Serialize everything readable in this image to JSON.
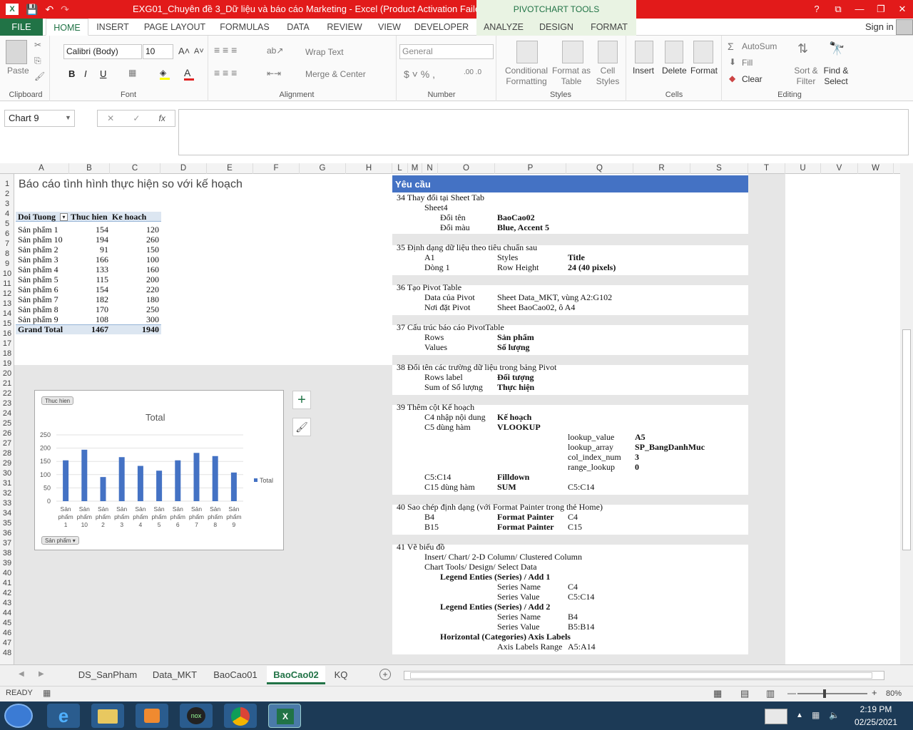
{
  "window": {
    "title": "EXG01_Chuyên đề 3_Dữ liệu và báo cáo Marketing -  Excel (Product Activation Failed)",
    "contextual_tab": "PIVOTCHART TOOLS",
    "controls": [
      "?",
      "⧉",
      "—",
      "❐",
      "✕"
    ]
  },
  "ribbon_tabs": [
    "FILE",
    "HOME",
    "INSERT",
    "PAGE LAYOUT",
    "FORMULAS",
    "DATA",
    "REVIEW",
    "VIEW",
    "DEVELOPER",
    "ANALYZE",
    "DESIGN",
    "FORMAT"
  ],
  "signin": "Sign in",
  "ribbon": {
    "clipboard": {
      "paste": "Paste",
      "label": "Clipboard"
    },
    "font": {
      "name": "Calibri (Body)",
      "size": "10",
      "label": "Font"
    },
    "alignment": {
      "wrap": "Wrap Text",
      "merge": "Merge & Center",
      "label": "Alignment"
    },
    "number": {
      "format": "General",
      "label": "Number"
    },
    "styles": {
      "cond": "Conditional",
      "cond2": "Formatting",
      "fmt": "Format as",
      "fmt2": "Table",
      "cell": "Cell",
      "cell2": "Styles",
      "label": "Styles"
    },
    "cells": {
      "insert": "Insert",
      "delete": "Delete",
      "format": "Format",
      "label": "Cells"
    },
    "editing": {
      "autosum": "AutoSum",
      "fill": "Fill",
      "clear": "Clear",
      "sort": "Sort &",
      "sort2": "Filter",
      "find": "Find &",
      "find2": "Select",
      "label": "Editing"
    }
  },
  "formula_bar": {
    "name_box": "Chart 9",
    "fx": "fx",
    "content": ""
  },
  "columns": [
    "A",
    "B",
    "C",
    "D",
    "E",
    "F",
    "G",
    "H",
    "L",
    "M",
    "N",
    "O",
    "P",
    "Q",
    "R",
    "S",
    "T",
    "U",
    "V",
    "W"
  ],
  "rows": [
    "1",
    "2",
    "3",
    "4",
    "5",
    "6",
    "7",
    "8",
    "9",
    "10",
    "11",
    "12",
    "13",
    "14",
    "15",
    "16",
    "17",
    "18",
    "19",
    "20",
    "21",
    "22",
    "23",
    "24",
    "25",
    "26",
    "27",
    "28",
    "29",
    "30",
    "31",
    "32",
    "33",
    "34",
    "35",
    "36",
    "37",
    "38",
    "39",
    "40",
    "41",
    "42",
    "43",
    "44",
    "45",
    "46",
    "47",
    "48"
  ],
  "sheet": {
    "title": "Báo cáo tình hình thực hiện so với kế hoạch",
    "pivot_headers": [
      "Doi Tuong",
      "Thuc hien",
      "Ke hoach"
    ],
    "pivot_rows": [
      [
        "Sản phẩm 1",
        "154",
        "120"
      ],
      [
        "Sản phẩm 10",
        "194",
        "260"
      ],
      [
        "Sản phẩm 2",
        "91",
        "150"
      ],
      [
        "Sản phẩm 3",
        "166",
        "100"
      ],
      [
        "Sản phẩm 4",
        "133",
        "160"
      ],
      [
        "Sản phẩm 5",
        "115",
        "200"
      ],
      [
        "Sản phẩm 6",
        "154",
        "220"
      ],
      [
        "Sản phẩm 7",
        "182",
        "180"
      ],
      [
        "Sản phẩm 8",
        "170",
        "250"
      ],
      [
        "Sản phẩm 9",
        "108",
        "300"
      ]
    ],
    "grand_total": [
      "Grand Total",
      "1467",
      "1940"
    ]
  },
  "chart_data": {
    "type": "bar",
    "title": "Total",
    "field_button_top": "Thuc hien",
    "field_button_bottom": "Sản phẩm",
    "categories": [
      "Sản phẩm 1",
      "Sản phẩm 10",
      "Sản phẩm 2",
      "Sản phẩm 3",
      "Sản phẩm 4",
      "Sản phẩm 5",
      "Sản phẩm 6",
      "Sản phẩm 7",
      "Sản phẩm 8",
      "Sản phẩm 9"
    ],
    "category_lines": [
      [
        "Sản",
        "phẩm",
        "1"
      ],
      [
        "Sản",
        "phẩm",
        "10"
      ],
      [
        "Sản",
        "phẩm",
        "2"
      ],
      [
        "Sản",
        "phẩm",
        "3"
      ],
      [
        "Sản",
        "phẩm",
        "4"
      ],
      [
        "Sản",
        "phẩm",
        "5"
      ],
      [
        "Sản",
        "phẩm",
        "6"
      ],
      [
        "Sản",
        "phẩm",
        "7"
      ],
      [
        "Sản",
        "phẩm",
        "8"
      ],
      [
        "Sản",
        "phẩm",
        "9"
      ]
    ],
    "series": [
      {
        "name": "Total",
        "values": [
          154,
          194,
          91,
          166,
          133,
          115,
          154,
          182,
          170,
          108
        ],
        "color": "#4472c4"
      }
    ],
    "yticks": [
      "250",
      "200",
      "150",
      "100",
      "50",
      "0"
    ],
    "ylim": [
      0,
      250
    ],
    "legend_position": "right",
    "grid": true
  },
  "requirements": {
    "header": "Yêu cầu",
    "lines": [
      {
        "row": "34",
        "a": "34  Thay đổi tại Sheet Tab"
      },
      {
        "row": "35",
        "b": "Sheet4"
      },
      {
        "row": "36",
        "c": "Đổi tên",
        "d": "BaoCao02"
      },
      {
        "row": "37",
        "c": "Đổi màu",
        "d": "Blue, Accent 5"
      },
      {
        "row": "35b",
        "a": "35  Định dạng dữ liệu theo tiêu chuẩn sau"
      },
      {
        "b": "A1",
        "d2": "Styles",
        "e": "Title"
      },
      {
        "b": "Dòng 1",
        "d2": "Row Height",
        "e": "24 (40 pixels)"
      },
      {
        "a": "36  Tạo Pivot Table"
      },
      {
        "b": "Data của Pivot",
        "d2": "Sheet Data_MKT,  vùng A2:G102"
      },
      {
        "b": "Nơi đặt Pivot",
        "d2": "Sheet BaoCao02, ô A4"
      },
      {
        "a": "37  Cấu trúc báo cáo PivotTable"
      },
      {
        "b": "Rows",
        "d": "Sản phẩm"
      },
      {
        "b": "Values",
        "d": "Số lượng"
      },
      {
        "a": "38  Đổi tên các trường dữ liệu trong bảng Pivot"
      },
      {
        "b": "Rows label",
        "d": "Đối tượng"
      },
      {
        "b": "Sum of Số lượng",
        "d": "Thực hiện"
      },
      {
        "a": "39  Thêm cột Kế hoạch"
      },
      {
        "b": "C4 nhập nội dung",
        "d": "Kế hoạch"
      },
      {
        "b": "C5 dùng hàm",
        "d": "VLOOKUP"
      },
      {
        "e2": "lookup_value",
        "f": "A5"
      },
      {
        "e2": "lookup_array",
        "f": "SP_BangDanhMuc"
      },
      {
        "e2": "col_index_num",
        "f": "3"
      },
      {
        "e2": "range_lookup",
        "f": "0"
      },
      {
        "b": "C5:C14",
        "d": "Filldown"
      },
      {
        "b": "C15 dùng hàm",
        "d": "SUM",
        "e2": "C5:C14"
      },
      {
        "a": "40  Sao chép định dạng (với Format Painter trong thẻ Home)"
      },
      {
        "b": "B4",
        "d": "Format Painter",
        "e2": "C4"
      },
      {
        "b": "B15",
        "d": "Format Painter",
        "e2": "C15"
      },
      {
        "a": "41  Vẽ biểu đồ"
      },
      {
        "b": "Insert/ Chart/ 2-D Column/ Clustered Column"
      },
      {
        "b": "Chart Tools/ Design/ Select Data"
      },
      {
        "c": "Legend Enties (Series) / Add 1"
      },
      {
        "d2": "Series Name",
        "e2": "C4"
      },
      {
        "d2": "Series Value",
        "e2": "C5:C14"
      },
      {
        "c": "Legend Enties (Series) / Add 2"
      },
      {
        "d2": "Series Name",
        "e2": "B4"
      },
      {
        "d2": "Series Value",
        "e2": "B5:B14"
      },
      {
        "c": "Horizontal (Categories) Axis Labels"
      },
      {
        "d2": "Axis Labels Range",
        "e2": "A5:A14"
      }
    ]
  },
  "sheet_tabs": [
    "DS_SanPham",
    "Data_MKT",
    "BaoCao01",
    "BaoCao02",
    "KQ"
  ],
  "active_sheet": "BaoCao02",
  "status": {
    "ready": "READY",
    "zoom": "80%"
  },
  "taskbar": {
    "time": "2:19 PM",
    "date": "02/25/2021"
  }
}
